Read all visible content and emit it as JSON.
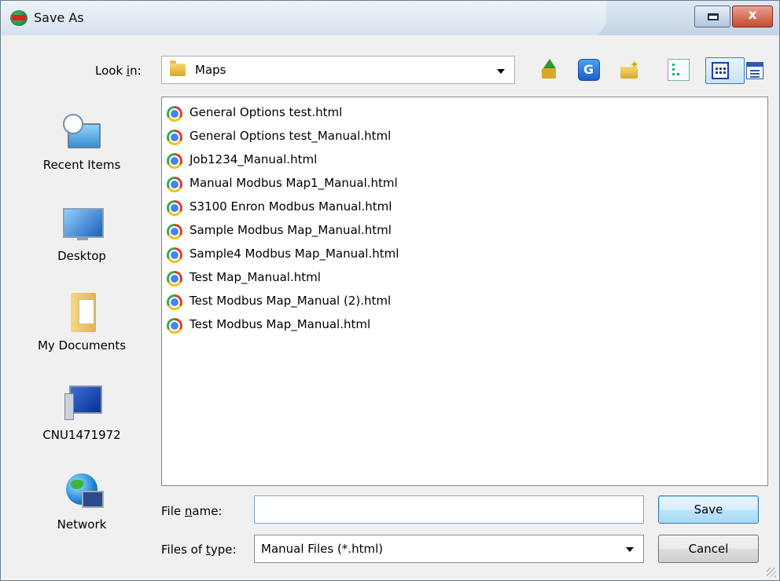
{
  "window": {
    "title": "Save As",
    "close_glyph": "x",
    "restore_icon": "restore-window-icon"
  },
  "toolbar": {
    "look_in_label": "Look in:",
    "look_in_value": "Maps",
    "look_in_icon": "folder-icon",
    "icons": [
      "up-one-level-icon",
      "refresh-icon",
      "new-folder-icon",
      "details-view-icon",
      "list-view-icon",
      "view-menu-icon"
    ]
  },
  "places": [
    {
      "label": "Recent Items",
      "icon": "recent-items-icon"
    },
    {
      "label": "Desktop",
      "icon": "desktop-icon"
    },
    {
      "label": "My Documents",
      "icon": "my-documents-icon"
    },
    {
      "label": "CNU1471972",
      "icon": "computer-icon"
    },
    {
      "label": "Network",
      "icon": "network-icon"
    }
  ],
  "files": [
    "General Options test.html",
    "General Options test_Manual.html",
    "Job1234_Manual.html",
    "Manual Modbus Map1_Manual.html",
    "S3100 Enron Modbus Manual.html",
    "Sample Modbus Map_Manual.html",
    "Sample4 Modbus Map_Manual.html",
    "Test Map_Manual.html",
    "Test Modbus Map_Manual (2).html",
    "Test Modbus Map_Manual.html"
  ],
  "file_icon": "chrome-icon",
  "form": {
    "file_name_label_pre": "File ",
    "file_name_label_key": "n",
    "file_name_label_post": "ame:",
    "file_name_value": "",
    "files_of_type_label_pre": "Files of ",
    "files_of_type_label_key": "t",
    "files_of_type_label_post": "ype:",
    "files_of_type_value": "Manual Files (*.html)"
  },
  "buttons": {
    "save": "Save",
    "cancel": "Cancel"
  },
  "colors": {
    "title_bar": "#c4d3e5",
    "close_button": "#c64a2f",
    "selected_view": "#c7e2f7",
    "dialog_bg": "#f0f0f0"
  }
}
